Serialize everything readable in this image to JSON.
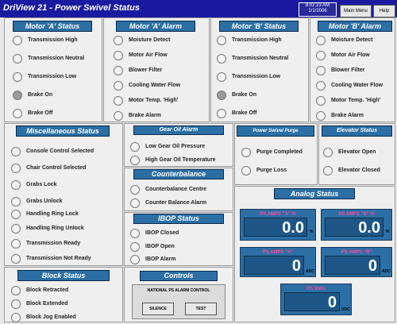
{
  "title": "DriView 21 - Power Swivel Status",
  "clock": {
    "line1": "8:02:23 AM",
    "line2": "1/1/2006"
  },
  "buttons": {
    "main_menu": "Main Menu",
    "help": "Help"
  },
  "motor_a_status": {
    "title": "Motor 'A' Status",
    "items": [
      "Transmission High",
      "Transmission Neutral",
      "Transmission Low",
      "Brake On",
      "Brake Off"
    ]
  },
  "motor_a_alarm": {
    "title": "Motor 'A' Alarm",
    "items": [
      "Moisture Detect",
      "Motor Air Flow",
      "Blower Filter",
      "Cooling Water Flow",
      "Motor Temp. 'High'",
      "Brake Alarm"
    ]
  },
  "motor_b_status": {
    "title": "Motor 'B' Status",
    "items": [
      "Transmission High",
      "Transmission Neutral",
      "Transmission Low",
      "Brake On",
      "Brake Off"
    ]
  },
  "motor_b_alarm": {
    "title": "Motor 'B' Alarm",
    "items": [
      "Moisture Detect",
      "Motor Air Flow",
      "Blower Filter",
      "Cooling Water Flow",
      "Motor Temp. 'High'",
      "Brake Alarm"
    ]
  },
  "misc_status": {
    "title": "Miscellaneous Status",
    "items": [
      "Console Control Selected",
      "Chair Control Selected",
      "Grabs Lock",
      "Grabs Unlock",
      "Handling Ring Lock",
      "Handling Ring Unlock",
      "Transmission Ready",
      "Transmission Not Ready"
    ]
  },
  "gear_oil_alarm": {
    "title": "Gear Oil Alarm",
    "items": [
      "Low Gear Oil Pressure",
      "High Gear Oil Temperature"
    ]
  },
  "counterbalance": {
    "title": "Counterbalance",
    "items": [
      "Counterbalance Centre",
      "Counter Balance Alarm"
    ]
  },
  "ibop_status": {
    "title": "IBOP Status",
    "items": [
      "IBOP Closed",
      "IBOP Open",
      "IBOP Alarm"
    ]
  },
  "controls": {
    "title": "Controls",
    "subtitle": "NATIONAL PS ALARM CONTROL",
    "silence": "SILENCE",
    "test": "TEST"
  },
  "block_status": {
    "title": "Block Status",
    "items": [
      "Block Retracted",
      "Block Extended",
      "Block Jog Enabled"
    ]
  },
  "power_swivel_purge": {
    "title": "Power Swivel Purge",
    "items": [
      "Purge Completed",
      "Purge Loss"
    ]
  },
  "elevator_status": {
    "title": "Elevator Status",
    "items": [
      "Elevator Open",
      "Elevator Closed"
    ]
  },
  "analog_status": {
    "title": "Analog Status",
    "amps_a_pct": {
      "label": "PS AMPS \"A\" %",
      "value": "0.0",
      "unit": "%"
    },
    "amps_b_pct": {
      "label": "PS AMPS \"B\" %",
      "value": "0.0",
      "unit": "%"
    },
    "amps_a": {
      "label": "PS AMPS \"A\"",
      "value": "0",
      "unit": "ADC"
    },
    "amps_b": {
      "label": "PS AMPS \"B\"",
      "value": "0",
      "unit": "ADC"
    },
    "volts": {
      "label": "PS Volts",
      "value": "0",
      "unit": "VDC"
    }
  },
  "colors": {
    "title_bar": "#1a1aa0",
    "header": "#2b6fa4",
    "analog_label": "#ff4aa0"
  }
}
